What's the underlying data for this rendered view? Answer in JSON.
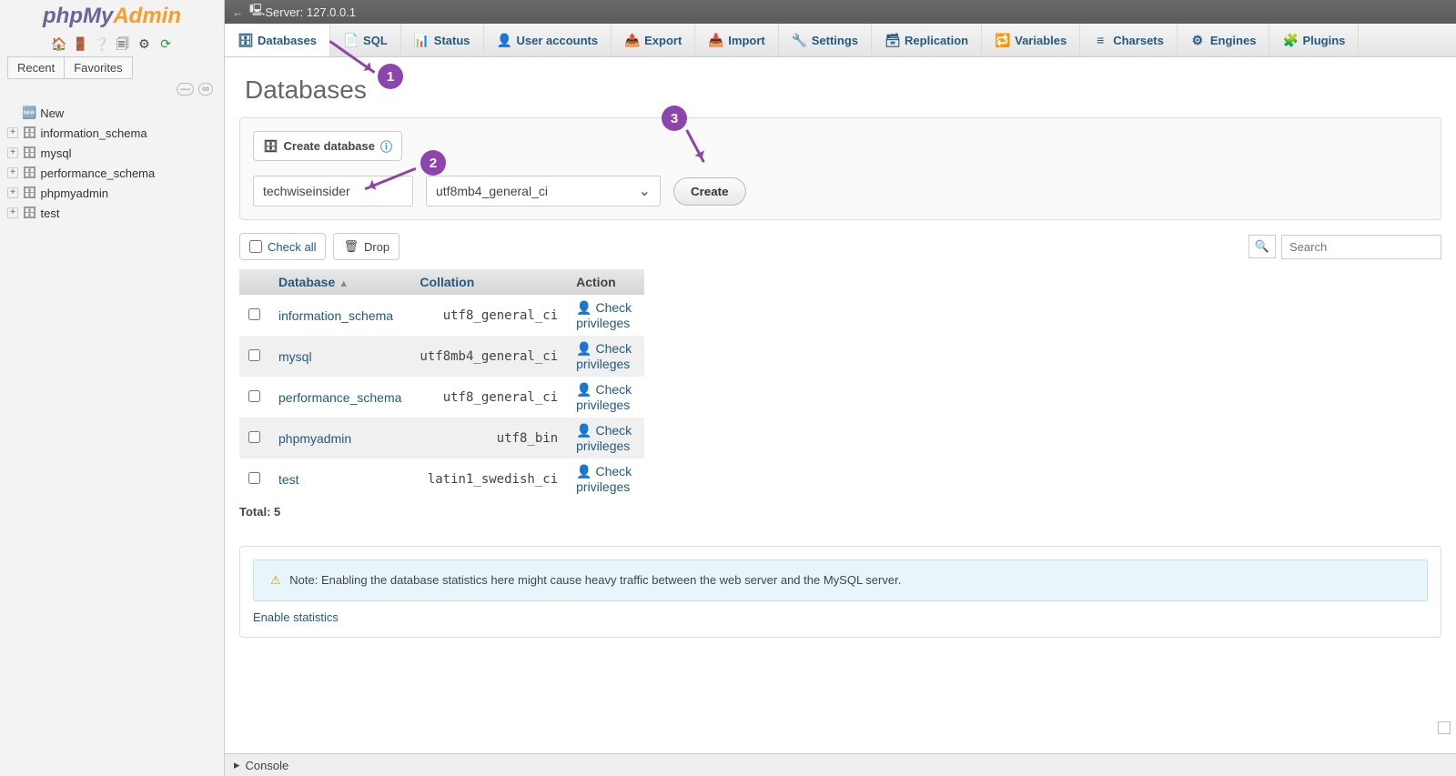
{
  "logo": {
    "php": "php",
    "my": "My",
    "admin": "Admin"
  },
  "sidebar": {
    "recent_label": "Recent",
    "favorites_label": "Favorites",
    "new_label": "New",
    "dbs": [
      "information_schema",
      "mysql",
      "performance_schema",
      "phpmyadmin",
      "test"
    ]
  },
  "topbar": {
    "back": "←",
    "server": "Server: 127.0.0.1"
  },
  "tabs": [
    {
      "label": "Databases",
      "icon": "🗄"
    },
    {
      "label": "SQL",
      "icon": "📄"
    },
    {
      "label": "Status",
      "icon": "📊"
    },
    {
      "label": "User accounts",
      "icon": "👤"
    },
    {
      "label": "Export",
      "icon": "📤"
    },
    {
      "label": "Import",
      "icon": "📥"
    },
    {
      "label": "Settings",
      "icon": "🔧"
    },
    {
      "label": "Replication",
      "icon": "🗃"
    },
    {
      "label": "Variables",
      "icon": "🔁"
    },
    {
      "label": "Charsets",
      "icon": "≡"
    },
    {
      "label": "Engines",
      "icon": "⚙"
    },
    {
      "label": "Plugins",
      "icon": "🧩"
    }
  ],
  "page_title": "Databases",
  "create_panel": {
    "heading": "Create database",
    "name_value": "techwiseinsider",
    "collation": "utf8mb4_general_ci",
    "button": "Create"
  },
  "toolbar": {
    "check_all": "Check all",
    "drop": "Drop"
  },
  "search": {
    "placeholder": "Search"
  },
  "table": {
    "headers": {
      "db": "Database",
      "coll": "Collation",
      "action": "Action"
    },
    "rows": [
      {
        "name": "information_schema",
        "coll": "utf8_general_ci",
        "action": "Check privileges"
      },
      {
        "name": "mysql",
        "coll": "utf8mb4_general_ci",
        "action": "Check privileges"
      },
      {
        "name": "performance_schema",
        "coll": "utf8_general_ci",
        "action": "Check privileges"
      },
      {
        "name": "phpmyadmin",
        "coll": "utf8_bin",
        "action": "Check privileges"
      },
      {
        "name": "test",
        "coll": "latin1_swedish_ci",
        "action": "Check privileges"
      }
    ],
    "total": "Total: 5"
  },
  "note": "Note: Enabling the database statistics here might cause heavy traffic between the web server and the MySQL server.",
  "enable_stats": "Enable statistics",
  "console": "Console",
  "callouts": {
    "c1": "1",
    "c2": "2",
    "c3": "3"
  }
}
